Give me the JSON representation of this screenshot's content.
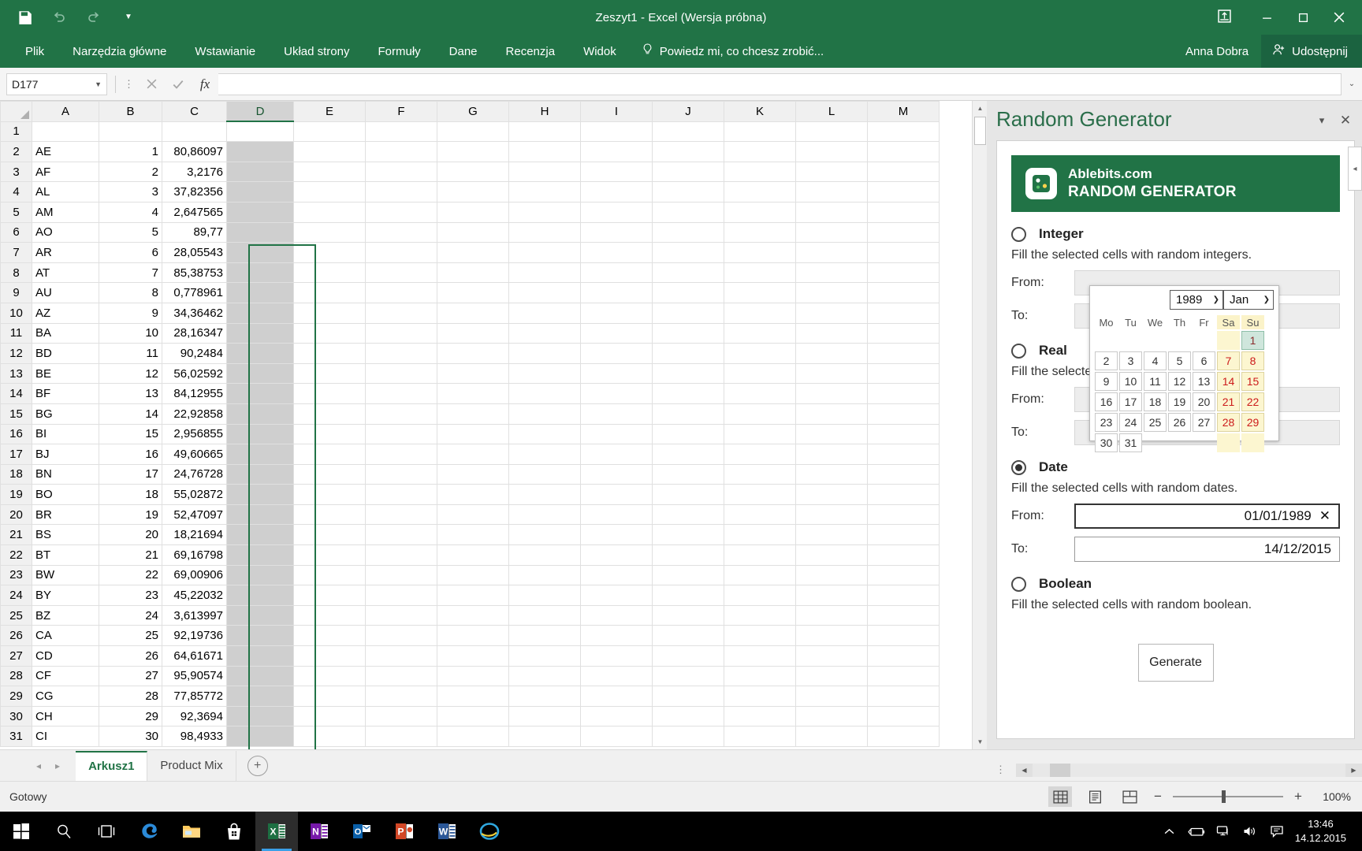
{
  "window": {
    "title": "Zeszyt1 - Excel (Wersja próbna)",
    "qat": [
      {
        "name": "save-icon",
        "glyph": "ὋE"
      },
      {
        "name": "undo-icon",
        "glyph": "↶"
      },
      {
        "name": "redo-icon",
        "glyph": "↷"
      },
      {
        "name": "customize-qat-icon",
        "glyph": "▾"
      }
    ],
    "controls": {
      "minimize": "─",
      "restore": "☐",
      "close": "✕",
      "ribbon_display": "⤓"
    }
  },
  "ribbon": {
    "tabs": [
      "Plik",
      "Narzędzia główne",
      "Wstawianie",
      "Układ strony",
      "Formuły",
      "Dane",
      "Recenzja",
      "Widok"
    ],
    "tellme": "Powiedz mi, co chcesz zrobić...",
    "username": "Anna Dobra",
    "share_label": "Udostępnij"
  },
  "formula_bar": {
    "name_box": "D177",
    "cancel_icon": "✕",
    "confirm_icon": "✓",
    "function_icon": "fx",
    "value": "",
    "expand_icon": "˅"
  },
  "grid": {
    "columns": [
      "A",
      "B",
      "C",
      "D",
      "E",
      "F",
      "G",
      "H",
      "I",
      "J",
      "K",
      "L",
      "M"
    ],
    "selected_column": "D",
    "rows": [
      {
        "n": "1",
        "a": "",
        "b": "",
        "c": ""
      },
      {
        "n": "2",
        "a": "AE",
        "b": "1",
        "c": "80,86097"
      },
      {
        "n": "3",
        "a": "AF",
        "b": "2",
        "c": "3,2176"
      },
      {
        "n": "4",
        "a": "AL",
        "b": "3",
        "c": "37,82356"
      },
      {
        "n": "5",
        "a": "AM",
        "b": "4",
        "c": "2,647565"
      },
      {
        "n": "6",
        "a": "AO",
        "b": "5",
        "c": "89,77"
      },
      {
        "n": "7",
        "a": "AR",
        "b": "6",
        "c": "28,05543"
      },
      {
        "n": "8",
        "a": "AT",
        "b": "7",
        "c": "85,38753"
      },
      {
        "n": "9",
        "a": "AU",
        "b": "8",
        "c": "0,778961"
      },
      {
        "n": "10",
        "a": "AZ",
        "b": "9",
        "c": "34,36462"
      },
      {
        "n": "11",
        "a": "BA",
        "b": "10",
        "c": "28,16347"
      },
      {
        "n": "12",
        "a": "BD",
        "b": "11",
        "c": "90,2484"
      },
      {
        "n": "13",
        "a": "BE",
        "b": "12",
        "c": "56,02592"
      },
      {
        "n": "14",
        "a": "BF",
        "b": "13",
        "c": "84,12955"
      },
      {
        "n": "15",
        "a": "BG",
        "b": "14",
        "c": "22,92858"
      },
      {
        "n": "16",
        "a": "BI",
        "b": "15",
        "c": "2,956855"
      },
      {
        "n": "17",
        "a": "BJ",
        "b": "16",
        "c": "49,60665"
      },
      {
        "n": "18",
        "a": "BN",
        "b": "17",
        "c": "24,76728"
      },
      {
        "n": "19",
        "a": "BO",
        "b": "18",
        "c": "55,02872"
      },
      {
        "n": "20",
        "a": "BR",
        "b": "19",
        "c": "52,47097"
      },
      {
        "n": "21",
        "a": "BS",
        "b": "20",
        "c": "18,21694"
      },
      {
        "n": "22",
        "a": "BT",
        "b": "21",
        "c": "69,16798"
      },
      {
        "n": "23",
        "a": "BW",
        "b": "22",
        "c": "69,00906"
      },
      {
        "n": "24",
        "a": "BY",
        "b": "23",
        "c": "45,22032"
      },
      {
        "n": "25",
        "a": "BZ",
        "b": "24",
        "c": "3,613997"
      },
      {
        "n": "26",
        "a": "CA",
        "b": "25",
        "c": "92,19736"
      },
      {
        "n": "27",
        "a": "CD",
        "b": "26",
        "c": "64,61671"
      },
      {
        "n": "28",
        "a": "CF",
        "b": "27",
        "c": "95,90574"
      },
      {
        "n": "29",
        "a": "CG",
        "b": "28",
        "c": "77,85772"
      },
      {
        "n": "30",
        "a": "CH",
        "b": "29",
        "c": "92,3694"
      },
      {
        "n": "31",
        "a": "CI",
        "b": "30",
        "c": "98,4933"
      }
    ]
  },
  "sheets": {
    "tabs": [
      "Arkusz1",
      "Product Mix"
    ],
    "active": "Arkusz1",
    "add_label": "+",
    "prev_icon": "◂",
    "next_icon": "▸"
  },
  "status": {
    "text": "Gotowy",
    "views": [
      "normal-view",
      "page-layout-view",
      "page-break-view"
    ],
    "active_view": "normal-view",
    "zoom_out": "−",
    "zoom_in": "+",
    "zoom_value": "100%"
  },
  "taskbar": {
    "items": [
      {
        "name": "start-button",
        "glyph": "⊞"
      },
      {
        "name": "search-icon",
        "glyph": "⚲"
      },
      {
        "name": "task-view-icon",
        "glyph": "❑"
      },
      {
        "name": "edge-icon",
        "glyph": "e"
      },
      {
        "name": "file-explorer-icon",
        "glyph": "Ὄ1"
      },
      {
        "name": "store-icon",
        "glyph": "ὬD"
      },
      {
        "name": "excel-icon",
        "glyph": "X"
      },
      {
        "name": "onenote-icon",
        "glyph": "N"
      },
      {
        "name": "outlook-icon",
        "glyph": "O"
      },
      {
        "name": "powerpoint-icon",
        "glyph": "P"
      },
      {
        "name": "word-icon",
        "glyph": "W"
      },
      {
        "name": "internet-explorer-icon",
        "glyph": "e"
      }
    ],
    "tray": [
      {
        "name": "show-hidden-icons",
        "glyph": "⌃"
      },
      {
        "name": "battery-icon",
        "glyph": "ὐB"
      },
      {
        "name": "network-icon",
        "glyph": "Ὓ5"
      },
      {
        "name": "volume-icon",
        "glyph": "ὐA"
      },
      {
        "name": "action-center-icon",
        "glyph": "὞8"
      }
    ],
    "time": "13:46",
    "date": "14.12.2015"
  },
  "pane": {
    "title": "Random Generator",
    "minimize_icon": "▾",
    "close_icon": "✕",
    "collapse_icon": "◂",
    "brand": {
      "line1": "Ablebits.com",
      "line2": "RANDOM GENERATOR"
    },
    "options": [
      {
        "key": "integer",
        "label": "Integer",
        "desc": "Fill the selected cells with random integers.",
        "selected": false,
        "from_label": "From:",
        "to_label": "To:",
        "from_value": "",
        "to_value": ""
      },
      {
        "key": "real",
        "label": "Real",
        "desc": "Fill the selected cells with random real numbers.",
        "selected": false,
        "from_label": "From:",
        "to_label": "To:",
        "from_value": "",
        "to_value": ""
      },
      {
        "key": "date",
        "label": "Date",
        "desc": "Fill the selected cells with random dates.",
        "selected": true,
        "from_label": "From:",
        "to_label": "To:",
        "from_value": "01/01/1989",
        "to_value": "14/12/2015",
        "clear_icon": "✕"
      },
      {
        "key": "boolean",
        "label": "Boolean",
        "desc": "Fill the selected cells with random boolean.",
        "selected": false
      }
    ],
    "generate_label": "Generate"
  },
  "calendar": {
    "year": "1989",
    "month": "Jan",
    "chevron": "⌄",
    "weekdays": [
      "Mo",
      "Tu",
      "We",
      "Th",
      "Fr",
      "Sa",
      "Su"
    ],
    "weekend_index": [
      5,
      6
    ],
    "weeks": [
      [
        "",
        "",
        "",
        "",
        "",
        "",
        "1"
      ],
      [
        "2",
        "3",
        "4",
        "5",
        "6",
        "7",
        "8"
      ],
      [
        "9",
        "10",
        "11",
        "12",
        "13",
        "14",
        "15"
      ],
      [
        "16",
        "17",
        "18",
        "19",
        "20",
        "21",
        "22"
      ],
      [
        "23",
        "24",
        "25",
        "26",
        "27",
        "28",
        "29"
      ],
      [
        "30",
        "31",
        "",
        "",
        "",
        "",
        ""
      ]
    ],
    "selected_day": "1"
  }
}
